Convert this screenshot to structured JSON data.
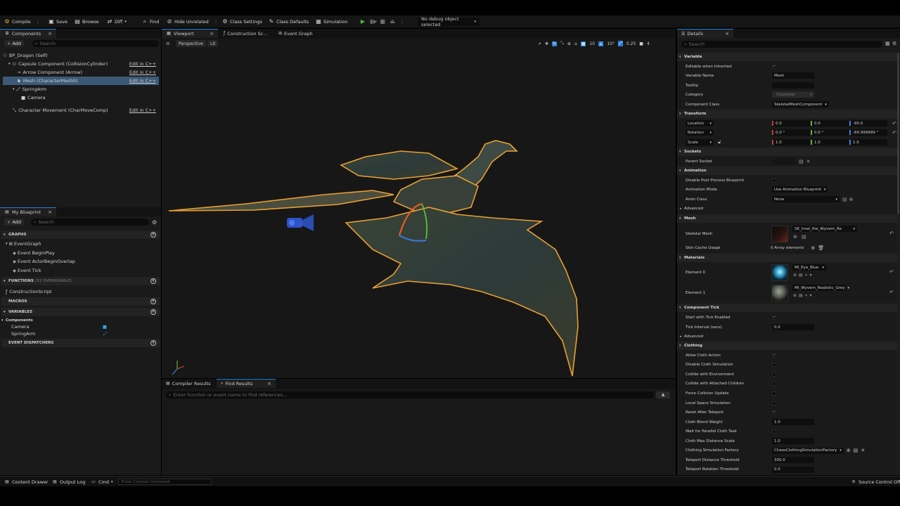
{
  "toolbar": {
    "compile": "Compile",
    "save": "Save",
    "browse": "Browse",
    "diff": "Diff",
    "find": "Find",
    "hide_unrelated": "Hide Unrelated",
    "class_settings": "Class Settings",
    "class_defaults": "Class Defaults",
    "simulation": "Simulation",
    "debug_select": "No debug object selected"
  },
  "components_panel": {
    "tab": "Components",
    "add": "Add",
    "search_placeholder": "Search",
    "tree": [
      {
        "label": "BP_Dragon (Self)",
        "edit": ""
      },
      {
        "label": "Capsule Component (CollisionCylinder)",
        "edit": "Edit in C++"
      },
      {
        "label": "Arrow Component (Arrow)",
        "edit": "Edit in C++"
      },
      {
        "label": "Mesh (CharacterMesh0)",
        "edit": "Edit in C++"
      },
      {
        "label": "SpringArm",
        "edit": ""
      },
      {
        "label": "Camera",
        "edit": ""
      },
      {
        "label": "Character Movement (CharMoveComp)",
        "edit": "Edit in C++"
      }
    ]
  },
  "my_blueprint": {
    "tab": "My Blueprint",
    "add": "Add",
    "search_placeholder": "Search",
    "graphs_header": "GRAPHS",
    "event_graph": "EventGraph",
    "events": [
      "Event BeginPlay",
      "Event ActorBeginOverlap",
      "Event Tick"
    ],
    "functions_header": "FUNCTIONS",
    "functions_hint": "(31 OVERRIDABLE)",
    "construction_script": "ConstructionScript",
    "macros_header": "MACROS",
    "variables_header": "VARIABLES",
    "components_group": "Components",
    "variables": [
      "Camera",
      "SpringArm"
    ],
    "dispatchers_header": "EVENT DISPATCHERS"
  },
  "center_tabs": [
    "Viewport",
    "Construction Sc...",
    "Event Graph"
  ],
  "viewport": {
    "perspective": "Perspective",
    "lit": "Lit",
    "grid_snap": "10",
    "rot_snap": "10°",
    "scale_snap": "0.25",
    "cam_speed": "4"
  },
  "bottom_tabs": {
    "compiler_results": "Compiler Results",
    "find_results": "Find Results",
    "find_placeholder": "Enter function or event name to find references..."
  },
  "details": {
    "tab": "Details",
    "search_placeholder": "Search",
    "sections": {
      "variable": "Variable",
      "transform": "Transform",
      "sockets": "Sockets",
      "animation": "Animation",
      "mesh": "Mesh",
      "materials": "Materials",
      "component_tick": "Component Tick",
      "clothing": "Clothing"
    },
    "variable": {
      "editable_label": "Editable when Inherited",
      "name_label": "Variable Name",
      "name_value": "Mesh",
      "tooltip_label": "Tooltip",
      "category_label": "Category",
      "category_value": "Character",
      "class_label": "Component Class",
      "class_value": "SkeletalMeshComponent"
    },
    "transform": {
      "location_label": "Location",
      "location": [
        "0.0",
        "0.0",
        "-90.0"
      ],
      "rotation_label": "Rotation",
      "rotation": [
        "0.0 °",
        "0.0 °",
        "-89.999999 °"
      ],
      "scale_label": "Scale",
      "scale": [
        "1.0",
        "1.0",
        "1.0"
      ]
    },
    "sockets": {
      "parent_label": "Parent Socket"
    },
    "animation": {
      "disable_post_label": "Disable Post Process Blueprint",
      "mode_label": "Animation Mode",
      "mode_value": "Use Animation Blueprint",
      "class_label": "Anim Class",
      "class_value": "None",
      "advanced": "Advanced"
    },
    "mesh": {
      "skeletal_label": "Skeletal Mesh",
      "skeletal_value": "SK_Irval_the_Wyvern_Re",
      "skin_cache_label": "Skin Cache Usage",
      "skin_cache_value": "0 Array elements"
    },
    "materials": {
      "el0_label": "Element 0",
      "el0_value": "MI_Eye_Blue",
      "el1_label": "Element 1",
      "el1_value": "MI_Wyvern_Realistic_Grey"
    },
    "component_tick": {
      "start_label": "Start with Tick Enabled",
      "interval_label": "Tick Interval (secs)",
      "interval_value": "0.0",
      "advanced": "Advanced"
    },
    "clothing": {
      "rows": [
        {
          "label": "Allow Cloth Actors",
          "type": "check",
          "checked": true
        },
        {
          "label": "Disable Cloth Simulation",
          "type": "check",
          "checked": false
        },
        {
          "label": "Collide with Environment",
          "type": "check",
          "checked": false
        },
        {
          "label": "Collide with Attached Children",
          "type": "check",
          "checked": false
        },
        {
          "label": "Force Collision Update",
          "type": "check",
          "checked": false
        },
        {
          "label": "Local Space Simulation",
          "type": "check",
          "checked": false
        },
        {
          "label": "Reset After Teleport",
          "type": "check",
          "checked": true
        },
        {
          "label": "Cloth Blend Weight",
          "type": "value",
          "value": "1.0"
        },
        {
          "label": "Wait for Parallel Cloth Task",
          "type": "check",
          "checked": false
        },
        {
          "label": "Cloth Max Distance Scale",
          "type": "value",
          "value": "1.0"
        },
        {
          "label": "Clothing Simulation Factory",
          "type": "combo",
          "value": "ChaosClothingSimulationFactory"
        },
        {
          "label": "Teleport Distance Threshold",
          "type": "value",
          "value": "300.0"
        },
        {
          "label": "Teleport Rotation Threshold",
          "type": "value",
          "value": "0.0"
        }
      ]
    }
  },
  "statusbar": {
    "content_drawer": "Content Drawer",
    "output_log": "Output Log",
    "cmd": "Cmd",
    "console_placeholder": "Enter Console Command",
    "source_control": "Source Control Off"
  },
  "colors": {
    "accent_blue": "#2b7fd8",
    "compile_gold": "#e0a630",
    "play_green": "#4cbb3a",
    "selection": "#3c5a78",
    "outline_orange": "#e8a030"
  }
}
